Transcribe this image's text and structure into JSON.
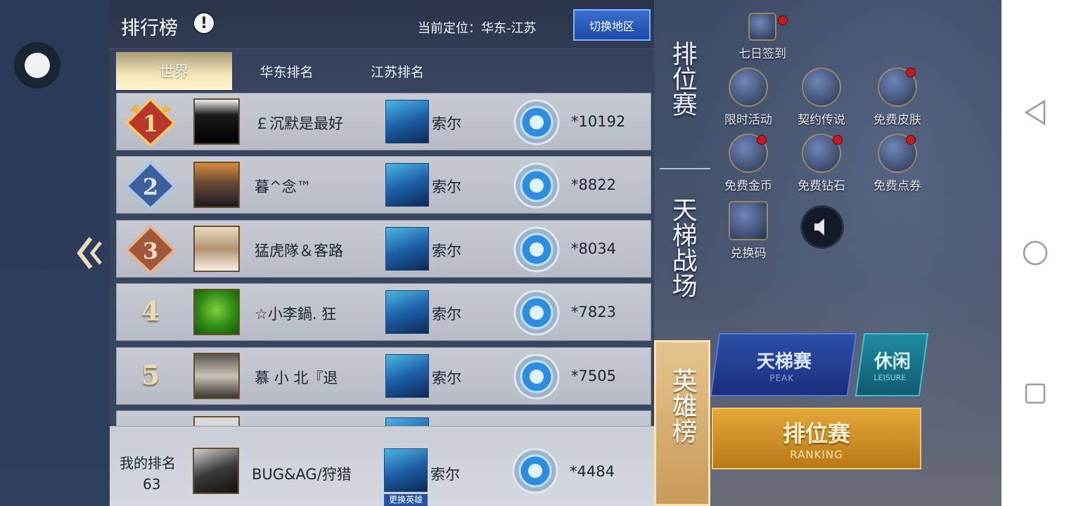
{
  "panel": {
    "title": "排行榜",
    "info_glyph": "!",
    "location_label": "当前定位：华东-江苏",
    "switch_button": "切换地区"
  },
  "tabs": [
    {
      "label": "世界",
      "active": true
    },
    {
      "label": "华东排名",
      "active": false
    },
    {
      "label": "江苏排名",
      "active": false
    }
  ],
  "rows": [
    {
      "rank": "1",
      "name": "￡沉默是最好",
      "hero": "索尔",
      "score": "*10192"
    },
    {
      "rank": "2",
      "name": "暮^念™",
      "hero": "索尔",
      "score": "*8822"
    },
    {
      "rank": "3",
      "name": "猛虎隊＆客路",
      "hero": "索尔",
      "score": "*8034"
    },
    {
      "rank": "4",
      "name": "☆小李鍋. 狂",
      "hero": "索尔",
      "score": "*7823"
    },
    {
      "rank": "5",
      "name": "慕 小 北『退",
      "hero": "索尔",
      "score": "*7505"
    }
  ],
  "my_rank": {
    "label": "我的排名",
    "rank": "63",
    "name": "BUG&AG/狩猎",
    "hero": "索尔",
    "score": "*4484",
    "change_hero": "更换英雄"
  },
  "side_tabs": [
    {
      "label": "排位赛",
      "active": false
    },
    {
      "label": "天梯战场",
      "active": false
    },
    {
      "label": "英雄榜",
      "active": true
    }
  ],
  "game_menu": {
    "icons": [
      {
        "label": "七日签到",
        "icon": "calendar-icon"
      },
      {
        "label": "限时活动",
        "icon": "chest-icon"
      },
      {
        "label": "契约传说",
        "icon": "hero-icon"
      },
      {
        "label": "免费皮肤",
        "icon": "skin-icon"
      },
      {
        "label": "免费金币",
        "icon": "gold-coin-icon"
      },
      {
        "label": "免费钻石",
        "icon": "diamond-icon"
      },
      {
        "label": "免费点券",
        "icon": "voucher-icon"
      },
      {
        "label": "兑换码",
        "icon": "tag-icon"
      }
    ],
    "peak": {
      "title": "天梯赛",
      "sub": "PEAK"
    },
    "leisure": {
      "title": "休闲",
      "sub": "LEISURE"
    },
    "ranking": {
      "title": "排位赛",
      "sub": "RANKING"
    }
  },
  "colors": {
    "panel_bg": "#37425c",
    "row_bg": "#c6cad3",
    "tab_active": "#efe2b6",
    "switch_btn": "#2a5cc0",
    "side_tab_active": "#d7b070"
  }
}
